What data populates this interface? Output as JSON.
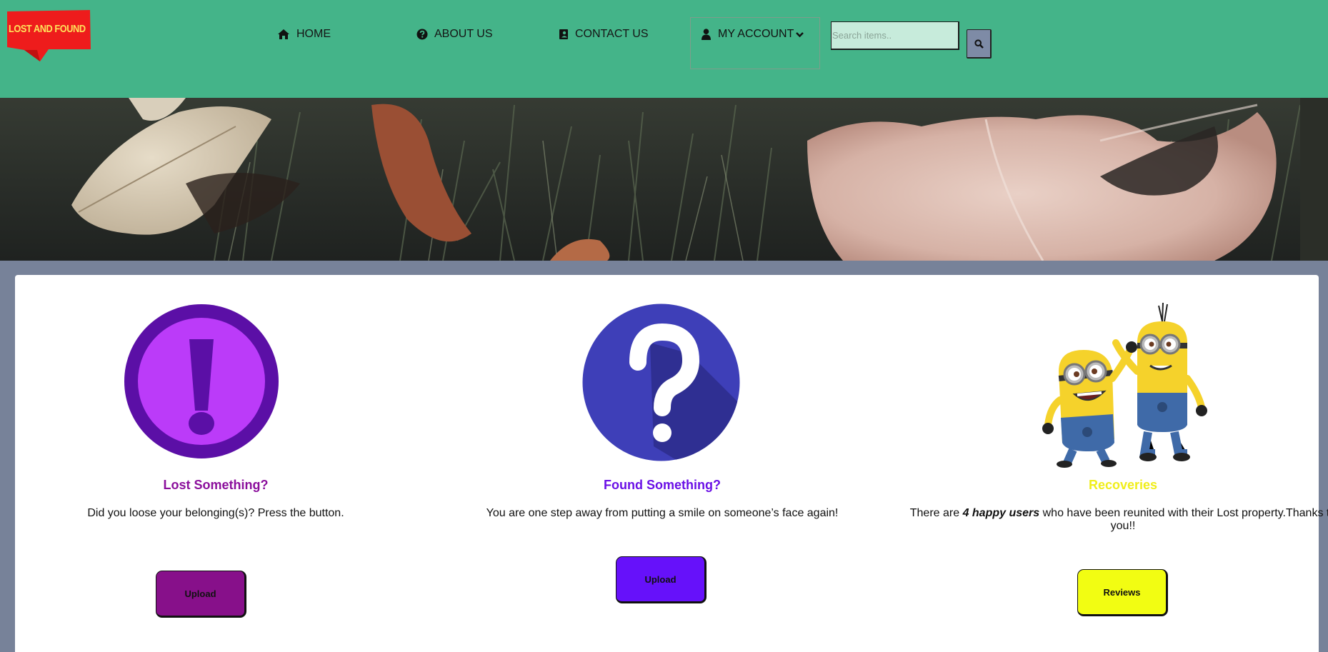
{
  "header": {
    "logo_text": "LOST AND FOUND",
    "background": "#44b489",
    "nav": [
      {
        "label": "HOME",
        "icon": "home-icon"
      },
      {
        "label": "ABOUT US",
        "icon": "question-circle-icon"
      },
      {
        "label": "CONTACT US",
        "icon": "contact-book-icon"
      }
    ],
    "account": {
      "label": "MY ACCOUNT",
      "icon": "user-icon",
      "caret_icon": "chevron-down-icon"
    },
    "search": {
      "placeholder": "Search items..",
      "value": "",
      "button_icon": "search-icon"
    }
  },
  "hero": {
    "image": "leaves-in-grass-photo"
  },
  "cards": [
    {
      "icon": "exclamation-circle-icon",
      "title": "Lost Something?",
      "title_color": "#8b0f9c",
      "text": "Did you loose your belonging(s)? Press the button.",
      "button_label": "Upload",
      "button_color": "#87108a"
    },
    {
      "icon": "question-circle-icon",
      "title": "Found Something?",
      "title_color": "#6a0fe6",
      "text": "You are one step away from putting a smile on someone’s face again!",
      "button_label": "Upload",
      "button_color": "#6611fa"
    },
    {
      "icon": "minions-illustration",
      "title": "Recoveries",
      "title_color": "#f0ee1a",
      "text_prefix": "There are ",
      "text_emphasis": "4 happy users",
      "text_suffix": " who have been reunited with their Lost property.Thanks to you!!",
      "button_label": "Reviews",
      "button_color": "#f2fd12"
    }
  ]
}
